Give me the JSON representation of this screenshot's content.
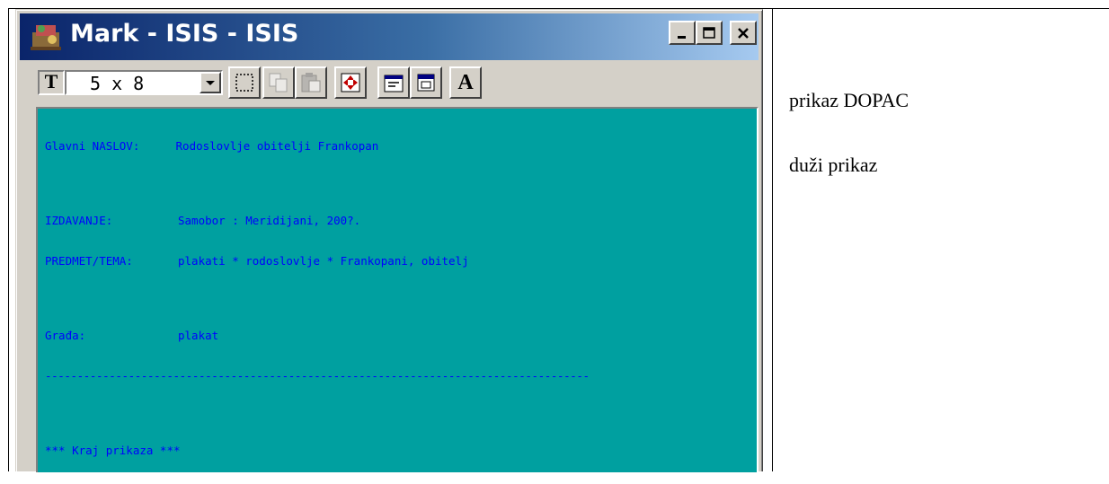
{
  "window": {
    "title": "Mark - ISIS - ISIS",
    "minimize_glyph": "_",
    "maximize_glyph": "□",
    "close_glyph": "×"
  },
  "toolbar": {
    "font_icon_text": "T",
    "font_size_value": "5 x 8",
    "buttons": [
      "select-all-icon",
      "copy-icon",
      "paste-icon",
      "fit-window-icon",
      "properties-icon",
      "new-window-icon",
      "font-a-icon"
    ],
    "font_button_label": "A"
  },
  "record": {
    "title_label": "Glavni NASLOV:",
    "title_value": "Rodoslovlje obitelji Frankopan",
    "publication_label": "IZDAVANJE:",
    "publication_value": "Samobor : Meridijani, 200?.",
    "subject_label": "PREDMET/TEMA:",
    "subject_value": "plakati * rodoslovlje * Frankopani, obitelj",
    "material_label": "Građa:",
    "material_value": "plakat",
    "separator": "-------------------------------------------------------------------------------------",
    "end_text": "*** Kraj prikaza ***"
  },
  "notes": {
    "line1": "prikaz DOPAC",
    "line2": "duži prikaz"
  },
  "colors": {
    "display_background": "#00a0a0",
    "display_text": "#0000ff",
    "titlebar_start": "#0a246a",
    "titlebar_end": "#a6caf0"
  }
}
